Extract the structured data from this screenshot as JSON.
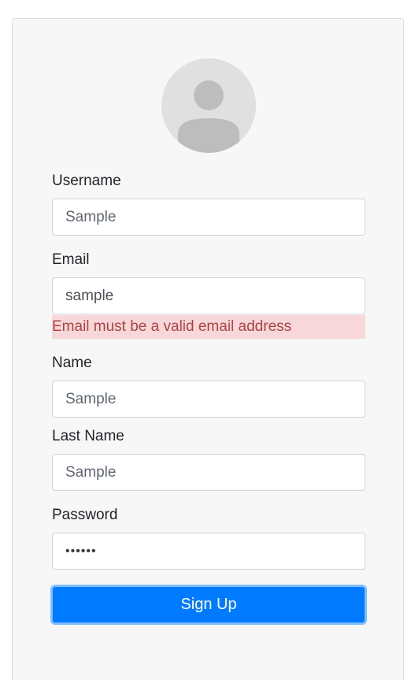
{
  "form": {
    "username": {
      "label": "Username",
      "value": "Sample"
    },
    "email": {
      "label": "Email",
      "value": "sample",
      "error": "Email must be a valid email address"
    },
    "name": {
      "label": "Name",
      "value": "Sample"
    },
    "last_name": {
      "label": "Last Name",
      "value": "Sample"
    },
    "password": {
      "label": "Password",
      "value": "••••••"
    },
    "submit_label": "Sign Up"
  },
  "colors": {
    "primary": "#007bff",
    "error_bg": "#f8d7da",
    "error_text": "#a94442",
    "card_bg": "#f7f7f7"
  },
  "avatar": {
    "icon": "user-avatar-icon"
  }
}
